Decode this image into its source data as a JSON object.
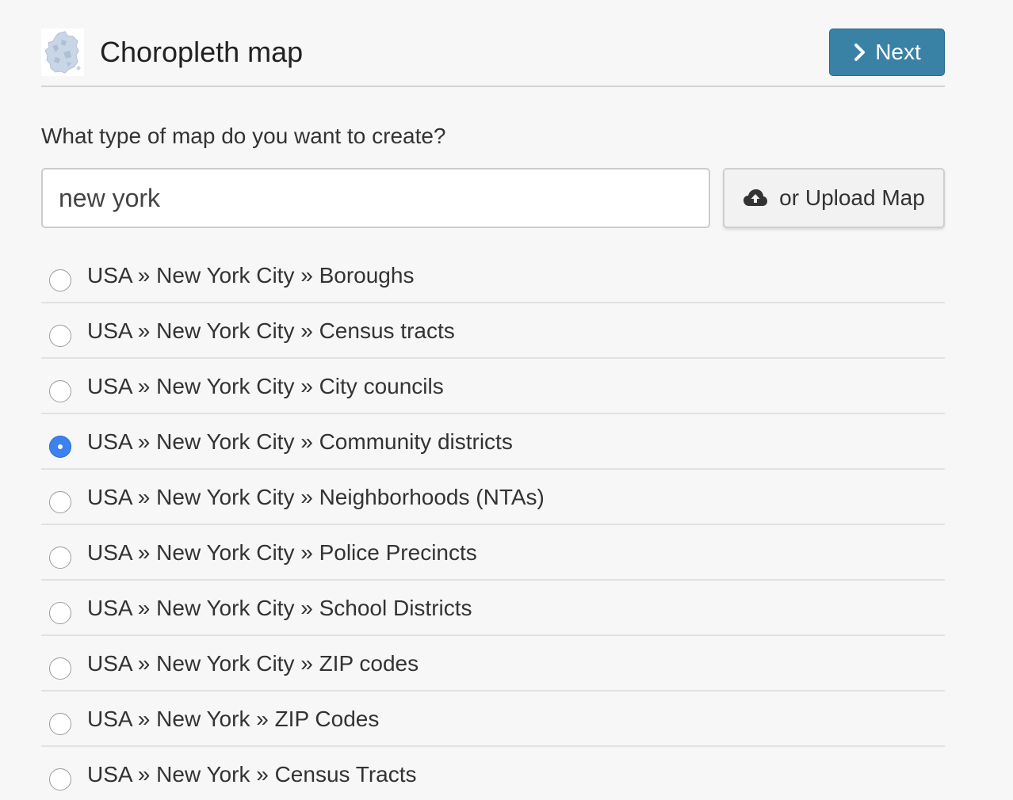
{
  "header": {
    "title": "Choropleth map",
    "thumbnail_icon": "france-map-icon",
    "next_label": "Next",
    "next_icon": "chevron-right-icon",
    "accent_color": "#3982a6"
  },
  "form": {
    "question": "What type of map do you want to create?",
    "search_value": "new york",
    "upload_label": "or Upload Map",
    "upload_icon": "cloud-upload-icon"
  },
  "options": [
    {
      "label": "USA » New York City » Boroughs",
      "selected": false
    },
    {
      "label": "USA » New York City » Census tracts",
      "selected": false
    },
    {
      "label": "USA » New York City » City councils",
      "selected": false
    },
    {
      "label": "USA » New York City » Community districts",
      "selected": true
    },
    {
      "label": "USA » New York City » Neighborhoods (NTAs)",
      "selected": false
    },
    {
      "label": "USA » New York City » Police Precincts",
      "selected": false
    },
    {
      "label": "USA » New York City » School Districts",
      "selected": false
    },
    {
      "label": "USA » New York City » ZIP codes",
      "selected": false
    },
    {
      "label": "USA » New York » ZIP Codes",
      "selected": false
    },
    {
      "label": "USA » New York » Census Tracts",
      "selected": false
    }
  ],
  "colors": {
    "radio_selected": "#3b82f0",
    "background": "#f7f7f7"
  }
}
